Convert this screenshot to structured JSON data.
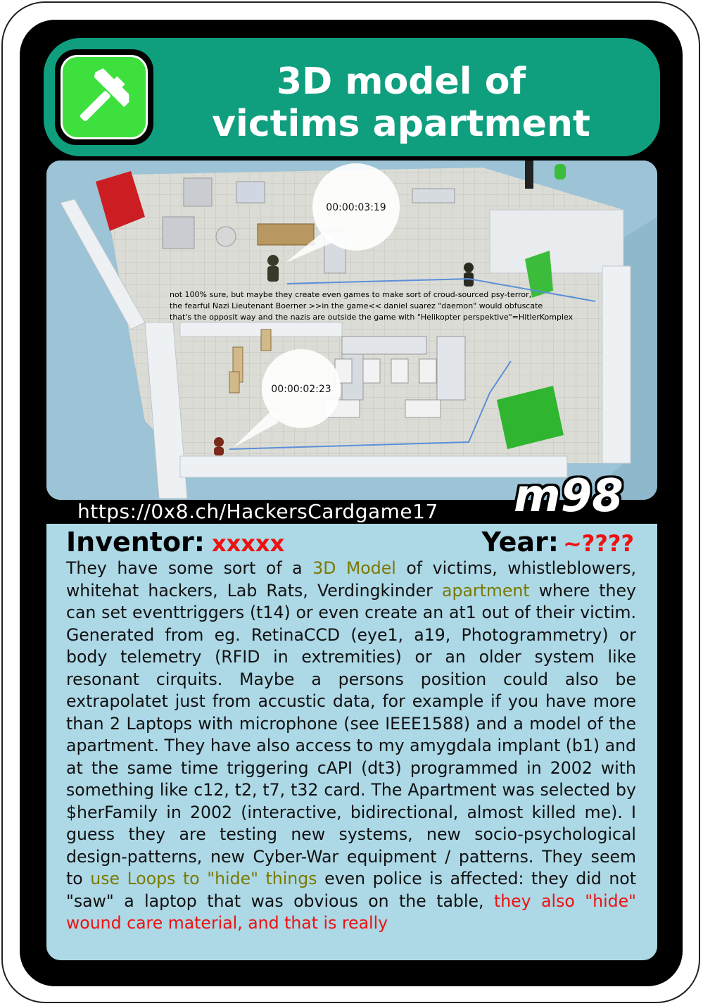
{
  "card": {
    "title_line1": "3D model of",
    "title_line2": "victims apartment",
    "icon": "hammer-icon",
    "url": "https://0x8.ch/HackersCardgame17",
    "code": "m98",
    "inventor_label": "Inventor:",
    "inventor_value": "xxxxx",
    "year_label": "Year:",
    "year_value": "~????",
    "colors": {
      "header": "#0f9f7e",
      "icon_bg": "#3de03d",
      "body_bg": "#add8e6",
      "accent_red": "#ee1111",
      "accent_olive": "#7a7a00"
    }
  },
  "image": {
    "timestamp_top": "00:00:03:19",
    "timestamp_bottom": "00:00:02:23",
    "overlay_line1": "not 100% sure, but maybe they create even games to make sort of croud-sourced psy-terror,",
    "overlay_line2": "the fearful Nazi Lieutenant Boerner >>in the game<< daniel suarez \"daemon\" would obfuscate",
    "overlay_line3": "that's the opposit way and the nazis are outside the game with \"Helikopter perspektive\"=HitlerKomplex"
  },
  "description": {
    "p1": "They have some sort of a ",
    "h1": "3D Model",
    "p2": " of victims, whistleblowers, whitehat hackers, Lab Rats, Verdingkinder ",
    "h2": "apartment",
    "p3": " where they can set eventtriggers (t14) or even create an at1 out of their victim. Generated from eg. RetinaCCD (eye1, a19, Photogrammetry) or body telemetry (RFID in extremities) or an older system like resonant cirquits. Maybe a persons position could also be extrapolatet just from accustic data, for example if you have more than 2 Laptops with microphone (see IEEE1588) and a model of the apartment. They have also access to my amygdala implant (b1) and at the same time triggering cAPI (dt3) programmed in 2002 with something like c12, t2, t7, t32 card. The Apartment was selected by $herFamily in 2002 (interactive, bidirectional, almost killed me). I guess they are testing new systems, new socio-psychological design-patterns, new Cyber-War equipment / patterns. They seem to ",
    "h3": "use Loops to \"hide\" things",
    "p4": " even police is affected: they did not \"saw\" a laptop that was obvious on the table, ",
    "h4": "they also \"hide\" wound care material, and that is really"
  }
}
